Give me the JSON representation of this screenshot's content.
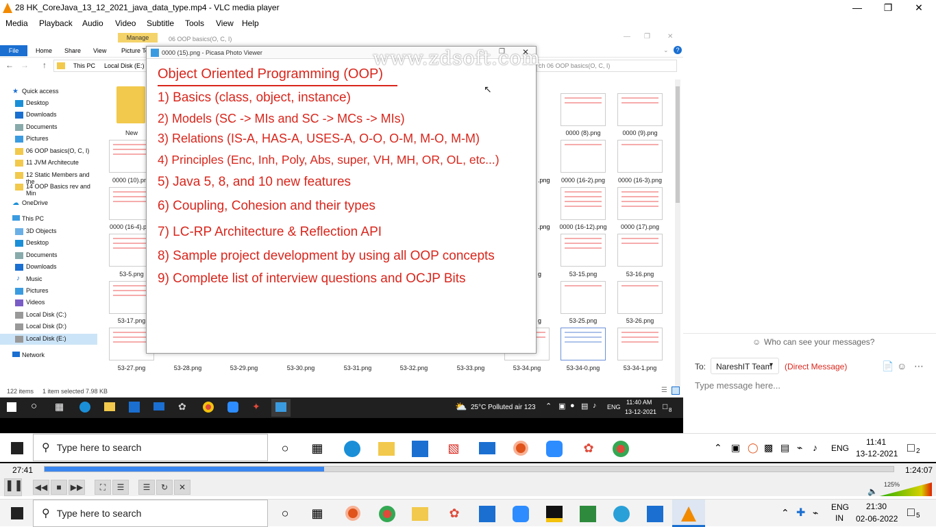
{
  "vlc": {
    "title": "28 HK_CoreJava_13_12_2021_java_data_type.mp4 - VLC media player",
    "menu": [
      "Media",
      "Playback",
      "Audio",
      "Video",
      "Subtitle",
      "Tools",
      "View",
      "Help"
    ],
    "time_elapsed": "27:41",
    "time_total": "1:24:07",
    "progress": 0.329,
    "volume": "125%"
  },
  "explorer": {
    "ribbon_tabs": [
      "File",
      "Home",
      "Share",
      "View",
      "Picture To"
    ],
    "manage_tab": "Manage",
    "window_title": "06 OOP basics(O, C, I)",
    "address": [
      "This PC",
      "Local Disk (E:)"
    ],
    "search_placeholder": "ch 06 OOP basics(O, C, I)",
    "quick_access": "Quick access",
    "quick_items": [
      "Desktop",
      "Downloads",
      "Documents",
      "Pictures",
      "06 OOP basics(O, C, I)",
      "11 JVM Architecute",
      "12 Static Members and the",
      "14 OOP Basics rev and Min"
    ],
    "onedrive": "OneDrive",
    "this_pc": "This PC",
    "pc_items": [
      "3D Objects",
      "Desktop",
      "Documents",
      "Downloads",
      "Music",
      "Pictures",
      "Videos",
      "Local Disk (C:)",
      "Local Disk (D:)",
      "Local Disk (E:)"
    ],
    "network": "Network",
    "status_items": "122 items",
    "status_selected": "1 item selected  7.98 KB",
    "left_files": [
      "New",
      "0000 (10).png",
      "0000 (16-4).png",
      "53-5.png",
      "53-17.png",
      "53-27.png"
    ],
    "right_files_a": [
      "0000 (8).png",
      "0000 (16-2).png",
      "0000 (16-12).png",
      "53-15.png",
      "53-25.png",
      "53-34-0.png"
    ],
    "right_files_b": [
      "0000 (9).png",
      "0000 (16-3).png",
      "0000 (17).png",
      "53-16.png",
      "53-26.png",
      "53-34-1.png"
    ],
    "partial_labels": [
      ".png",
      ".png",
      "g",
      "g"
    ],
    "bottom_row": [
      "53-28.png",
      "53-29.png",
      "53-30.png",
      "53-31.png",
      "53-32.png",
      "53-33.png",
      "53-34.png"
    ]
  },
  "picasa": {
    "title": "0000 (15).png - Picasa Photo Viewer",
    "watermark": "www.zdsoft.com",
    "heading": "Object Oriented Programming (OOP)",
    "items": [
      "1) Basics (class, object, instance)",
      "2) Models (SC -> MIs  and SC -> MCs -> MIs)",
      "3) Relations (IS-A, HAS-A, USES-A, O-O, O-M, M-O, M-M)",
      "4) Principles (Enc, Inh, Poly, Abs, super, VH, MH, OR, OL, etc...)",
      "5) Java 5, 8, and  10 new features",
      "6) Coupling, Cohesion and their types",
      "7) LC-RP Architecture & Reflection API",
      "8) Sample project development by using all OOP concepts",
      "9) Complete list of interview questions and OCJP Bits"
    ]
  },
  "chat": {
    "who_can_see": "Who can see your messages?",
    "to_label": "To:",
    "recipient": "NareshIT Team",
    "direct": "(Direct Message)",
    "input_placeholder": "Type message here..."
  },
  "inner_taskbar": {
    "weather": "25°C  Polluted air 123",
    "lang": "ENG",
    "time": "11:40 AM",
    "date": "13-12-2021",
    "notif_count": "8"
  },
  "outer_taskbar": {
    "search": "Type here to search",
    "lang": "ENG",
    "time": "11:41",
    "date": "13-12-2021",
    "notif_count": "2"
  },
  "bottom_taskbar": {
    "search": "Type here to search",
    "lang": "ENG",
    "region": "IN",
    "time": "21:30",
    "date": "02-06-2022",
    "notif_count": "5"
  }
}
